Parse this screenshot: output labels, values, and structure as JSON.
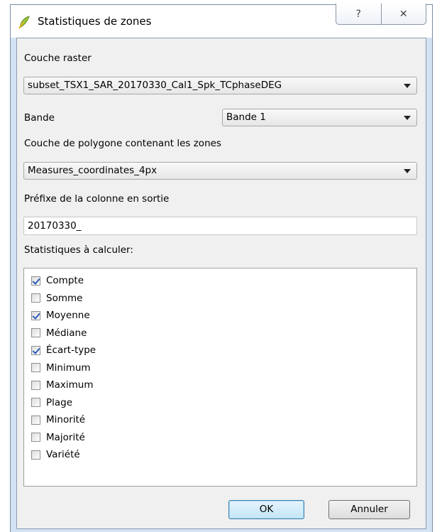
{
  "window": {
    "title": "Statistiques de zones",
    "help_glyph": "?",
    "close_glyph": "✕",
    "icon": "qgis-logo-icon"
  },
  "form": {
    "raster_layer_label": "Couche raster",
    "raster_layer_value": "subset_TSX1_SAR_20170330_Cal1_Spk_TCphaseDEG",
    "band_label": "Bande",
    "band_value": "Bande 1",
    "polygon_layer_label": "Couche de polygone contenant les zones",
    "polygon_layer_value": "Measures_coordinates_4px",
    "prefix_label": "Préfixe de la colonne en sortie",
    "prefix_value": "20170330_",
    "stats_label": "Statistiques à calculer:"
  },
  "stats": [
    {
      "label": "Compte",
      "checked": true
    },
    {
      "label": "Somme",
      "checked": false
    },
    {
      "label": "Moyenne",
      "checked": true
    },
    {
      "label": "Médiane",
      "checked": false
    },
    {
      "label": "Écart-type",
      "checked": true
    },
    {
      "label": "Minimum",
      "checked": false
    },
    {
      "label": "Maximum",
      "checked": false
    },
    {
      "label": "Plage",
      "checked": false
    },
    {
      "label": "Minorité",
      "checked": false
    },
    {
      "label": "Majorité",
      "checked": false
    },
    {
      "label": "Variété",
      "checked": false
    }
  ],
  "buttons": {
    "ok": "OK",
    "cancel": "Annuler"
  }
}
